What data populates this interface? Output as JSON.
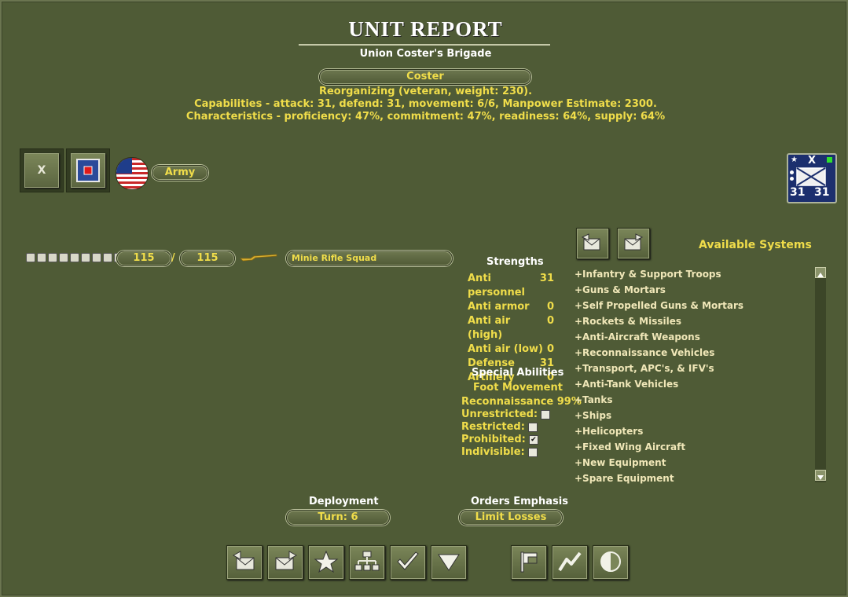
{
  "header": {
    "title": "UNIT REPORT",
    "subtitle": "Union Coster's Brigade"
  },
  "unit": {
    "name": "Coster",
    "status": "Reorganizing (veteran, weight: 230).",
    "capabilities": "Capabilities - attack: 31, defend: 31, movement: 6/6, Manpower Estimate: 2300.",
    "characteristics": "Characteristics - proficiency: 47%, commitment: 47%, readiness: 64%, supply: 64%"
  },
  "badges": {
    "size_label": "X",
    "branch": "Army"
  },
  "counter": {
    "size": "X",
    "attack": "31",
    "defense": "31"
  },
  "equipment": {
    "current": "115",
    "separator": "/",
    "max": "115",
    "name": "Minie Rifle Squad",
    "bar_fraction": 1.0
  },
  "strengths": {
    "heading": "Strengths",
    "rows": [
      {
        "label": "Anti personnel",
        "value": "31"
      },
      {
        "label": "Anti armor",
        "value": "0"
      },
      {
        "label": "Anti air (high)",
        "value": "0"
      },
      {
        "label": "Anti air (low)",
        "value": "0"
      },
      {
        "label": "Defense",
        "value": "31"
      },
      {
        "label": "Artillery",
        "value": "0"
      }
    ]
  },
  "special": {
    "heading": "Special Abilities",
    "movement": "Foot Movement",
    "recon": "Reconnaissance 99%",
    "unrestricted": "Unrestricted:",
    "restricted": "Restricted:",
    "prohibited": "Prohibited:",
    "indivisible": "Indivisible:",
    "prohibited_checked": true
  },
  "systems": {
    "heading": "Available Systems",
    "items": [
      "+Infantry & Support Troops",
      "+Guns & Mortars",
      "+Self Propelled Guns & Mortars",
      "+Rockets & Missiles",
      "+Anti-Aircraft Weapons",
      "+Reconnaissance Vehicles",
      "+Transport, APC's, & IFV's",
      "+Anti-Tank Vehicles",
      "+Tanks",
      "+Ships",
      "+Helicopters",
      "+Fixed Wing Aircraft",
      "+New Equipment",
      "+Spare Equipment"
    ]
  },
  "deployment": {
    "heading": "Deployment",
    "value": "Turn: 6"
  },
  "orders": {
    "heading": "Orders Emphasis",
    "value": "Limit Losses"
  },
  "icons": {
    "previous": "previous-unit-icon",
    "next": "next-unit-icon",
    "star": "star-icon",
    "hierarchy": "org-chart-icon",
    "check": "checkmark-icon",
    "down": "down-arrow-icon",
    "flag": "flag-icon",
    "chart": "line-chart-icon",
    "contrast": "half-circle-icon"
  },
  "colors": {
    "background": "#4f5b36",
    "text_yellow": "#f0dd4a",
    "counter_blue": "#1c2f6e"
  }
}
